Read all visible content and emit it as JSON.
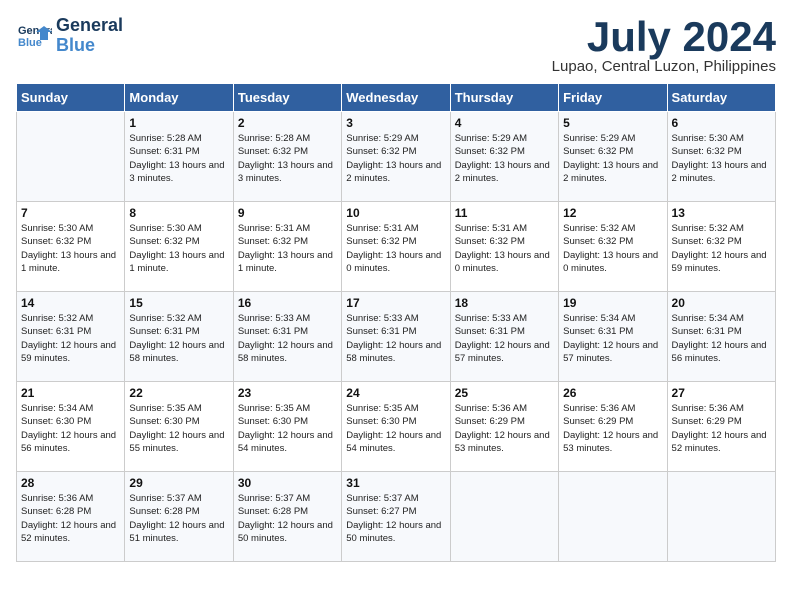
{
  "header": {
    "logo_line1": "General",
    "logo_line2": "Blue",
    "month": "July 2024",
    "location": "Lupao, Central Luzon, Philippines"
  },
  "weekdays": [
    "Sunday",
    "Monday",
    "Tuesday",
    "Wednesday",
    "Thursday",
    "Friday",
    "Saturday"
  ],
  "weeks": [
    [
      {
        "day": "",
        "info": ""
      },
      {
        "day": "1",
        "info": "Sunrise: 5:28 AM\nSunset: 6:31 PM\nDaylight: 13 hours\nand 3 minutes."
      },
      {
        "day": "2",
        "info": "Sunrise: 5:28 AM\nSunset: 6:32 PM\nDaylight: 13 hours\nand 3 minutes."
      },
      {
        "day": "3",
        "info": "Sunrise: 5:29 AM\nSunset: 6:32 PM\nDaylight: 13 hours\nand 2 minutes."
      },
      {
        "day": "4",
        "info": "Sunrise: 5:29 AM\nSunset: 6:32 PM\nDaylight: 13 hours\nand 2 minutes."
      },
      {
        "day": "5",
        "info": "Sunrise: 5:29 AM\nSunset: 6:32 PM\nDaylight: 13 hours\nand 2 minutes."
      },
      {
        "day": "6",
        "info": "Sunrise: 5:30 AM\nSunset: 6:32 PM\nDaylight: 13 hours\nand 2 minutes."
      }
    ],
    [
      {
        "day": "7",
        "info": "Sunrise: 5:30 AM\nSunset: 6:32 PM\nDaylight: 13 hours\nand 1 minute."
      },
      {
        "day": "8",
        "info": "Sunrise: 5:30 AM\nSunset: 6:32 PM\nDaylight: 13 hours\nand 1 minute."
      },
      {
        "day": "9",
        "info": "Sunrise: 5:31 AM\nSunset: 6:32 PM\nDaylight: 13 hours\nand 1 minute."
      },
      {
        "day": "10",
        "info": "Sunrise: 5:31 AM\nSunset: 6:32 PM\nDaylight: 13 hours\nand 0 minutes."
      },
      {
        "day": "11",
        "info": "Sunrise: 5:31 AM\nSunset: 6:32 PM\nDaylight: 13 hours\nand 0 minutes."
      },
      {
        "day": "12",
        "info": "Sunrise: 5:32 AM\nSunset: 6:32 PM\nDaylight: 13 hours\nand 0 minutes."
      },
      {
        "day": "13",
        "info": "Sunrise: 5:32 AM\nSunset: 6:32 PM\nDaylight: 12 hours\nand 59 minutes."
      }
    ],
    [
      {
        "day": "14",
        "info": "Sunrise: 5:32 AM\nSunset: 6:31 PM\nDaylight: 12 hours\nand 59 minutes."
      },
      {
        "day": "15",
        "info": "Sunrise: 5:32 AM\nSunset: 6:31 PM\nDaylight: 12 hours\nand 58 minutes."
      },
      {
        "day": "16",
        "info": "Sunrise: 5:33 AM\nSunset: 6:31 PM\nDaylight: 12 hours\nand 58 minutes."
      },
      {
        "day": "17",
        "info": "Sunrise: 5:33 AM\nSunset: 6:31 PM\nDaylight: 12 hours\nand 58 minutes."
      },
      {
        "day": "18",
        "info": "Sunrise: 5:33 AM\nSunset: 6:31 PM\nDaylight: 12 hours\nand 57 minutes."
      },
      {
        "day": "19",
        "info": "Sunrise: 5:34 AM\nSunset: 6:31 PM\nDaylight: 12 hours\nand 57 minutes."
      },
      {
        "day": "20",
        "info": "Sunrise: 5:34 AM\nSunset: 6:31 PM\nDaylight: 12 hours\nand 56 minutes."
      }
    ],
    [
      {
        "day": "21",
        "info": "Sunrise: 5:34 AM\nSunset: 6:30 PM\nDaylight: 12 hours\nand 56 minutes."
      },
      {
        "day": "22",
        "info": "Sunrise: 5:35 AM\nSunset: 6:30 PM\nDaylight: 12 hours\nand 55 minutes."
      },
      {
        "day": "23",
        "info": "Sunrise: 5:35 AM\nSunset: 6:30 PM\nDaylight: 12 hours\nand 54 minutes."
      },
      {
        "day": "24",
        "info": "Sunrise: 5:35 AM\nSunset: 6:30 PM\nDaylight: 12 hours\nand 54 minutes."
      },
      {
        "day": "25",
        "info": "Sunrise: 5:36 AM\nSunset: 6:29 PM\nDaylight: 12 hours\nand 53 minutes."
      },
      {
        "day": "26",
        "info": "Sunrise: 5:36 AM\nSunset: 6:29 PM\nDaylight: 12 hours\nand 53 minutes."
      },
      {
        "day": "27",
        "info": "Sunrise: 5:36 AM\nSunset: 6:29 PM\nDaylight: 12 hours\nand 52 minutes."
      }
    ],
    [
      {
        "day": "28",
        "info": "Sunrise: 5:36 AM\nSunset: 6:28 PM\nDaylight: 12 hours\nand 52 minutes."
      },
      {
        "day": "29",
        "info": "Sunrise: 5:37 AM\nSunset: 6:28 PM\nDaylight: 12 hours\nand 51 minutes."
      },
      {
        "day": "30",
        "info": "Sunrise: 5:37 AM\nSunset: 6:28 PM\nDaylight: 12 hours\nand 50 minutes."
      },
      {
        "day": "31",
        "info": "Sunrise: 5:37 AM\nSunset: 6:27 PM\nDaylight: 12 hours\nand 50 minutes."
      },
      {
        "day": "",
        "info": ""
      },
      {
        "day": "",
        "info": ""
      },
      {
        "day": "",
        "info": ""
      }
    ]
  ]
}
